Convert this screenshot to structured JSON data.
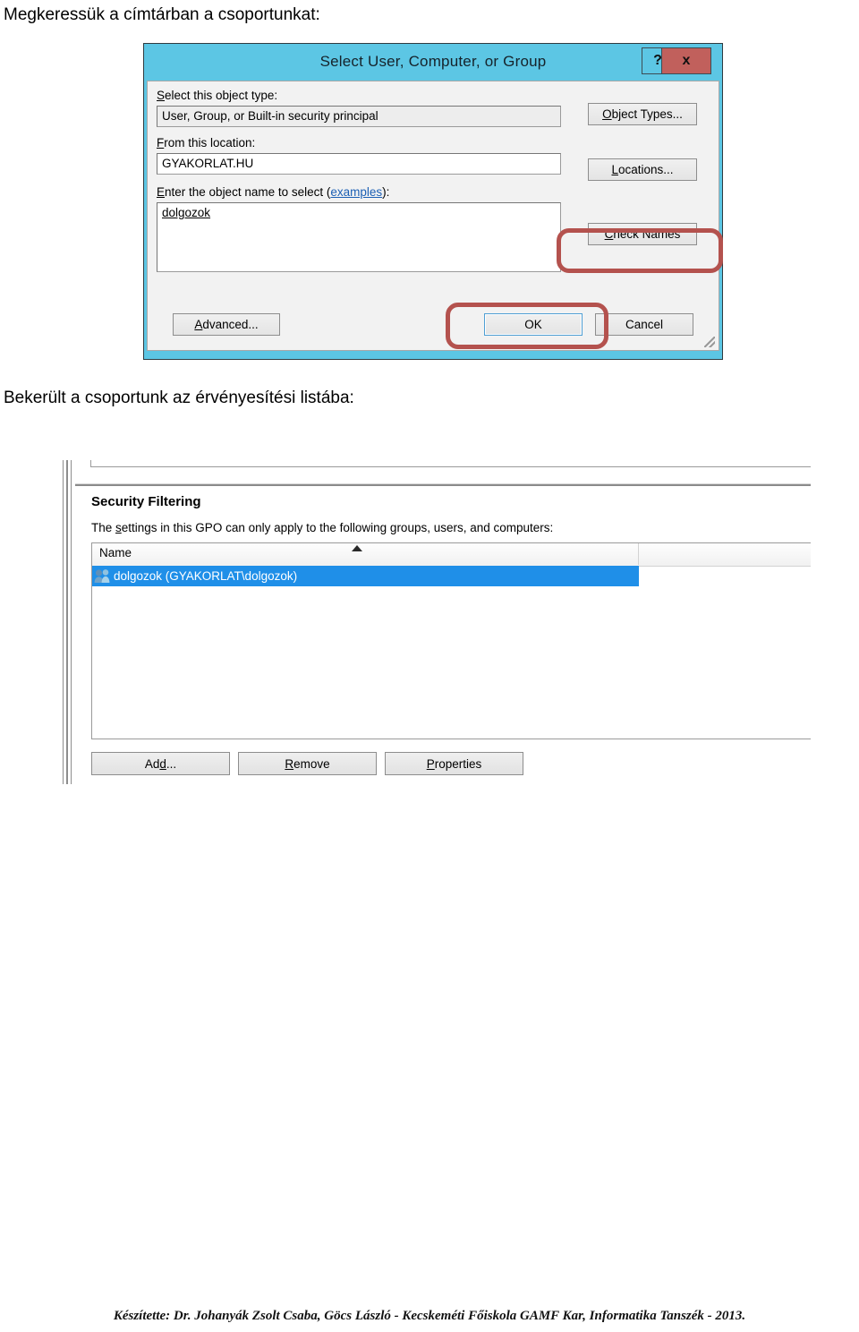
{
  "page": {
    "caption_top": "Megkeressük a címtárban a csoportunkat:",
    "caption_mid": "Bekerült a csoportunk az érvényesítési listába:",
    "footer": "Készítette: Dr. Johanyák Zsolt Csaba, Göcs László - Kecskeméti Főiskola GAMF Kar, Informatika Tanszék - 2013."
  },
  "colors": {
    "titlebar_blue": "#5cc6e4",
    "close_red": "#c1605c",
    "annotation_red": "#b4524e",
    "selection_blue": "#1f8fe8",
    "dialog_face": "#f2f2f2"
  },
  "select_dialog": {
    "title": "Select User, Computer, or Group",
    "help_button": "?",
    "close_button": "x",
    "object_type_label": "Select this object type:",
    "object_type_label_accel": "S",
    "object_type_value": "User, Group, or Built-in security principal",
    "object_types_button": "Object Types...",
    "object_types_button_accel": "O",
    "location_label": "From this location:",
    "location_label_accel": "F",
    "location_value": "GYAKORLAT.HU",
    "locations_button": "Locations...",
    "locations_button_accel": "L",
    "object_name_label_pre": "Enter the object name to select (",
    "object_name_label_link": "examples",
    "object_name_label_post": "):",
    "object_name_label_accel": "E",
    "object_name_value": "dolgozok",
    "check_names_button": "Check Names",
    "check_names_button_accel": "C",
    "advanced_button": "Advanced...",
    "advanced_button_accel": "A",
    "ok_button": "OK",
    "cancel_button": "Cancel"
  },
  "security_filtering": {
    "title": "Security Filtering",
    "description_pre": "The ",
    "description_accel": "s",
    "description_post": "ettings in this GPO can only apply to the following groups, users, and computers:",
    "column_name": "Name",
    "rows": [
      {
        "icon": "group-icon",
        "label": "dolgozok (GYAKORLAT\\dolgozok)",
        "selected": true
      }
    ],
    "add_button": "Add...",
    "add_button_accel": "d",
    "remove_button": "Remove",
    "remove_button_accel": "R",
    "properties_button": "Properties",
    "properties_button_accel": "P"
  }
}
